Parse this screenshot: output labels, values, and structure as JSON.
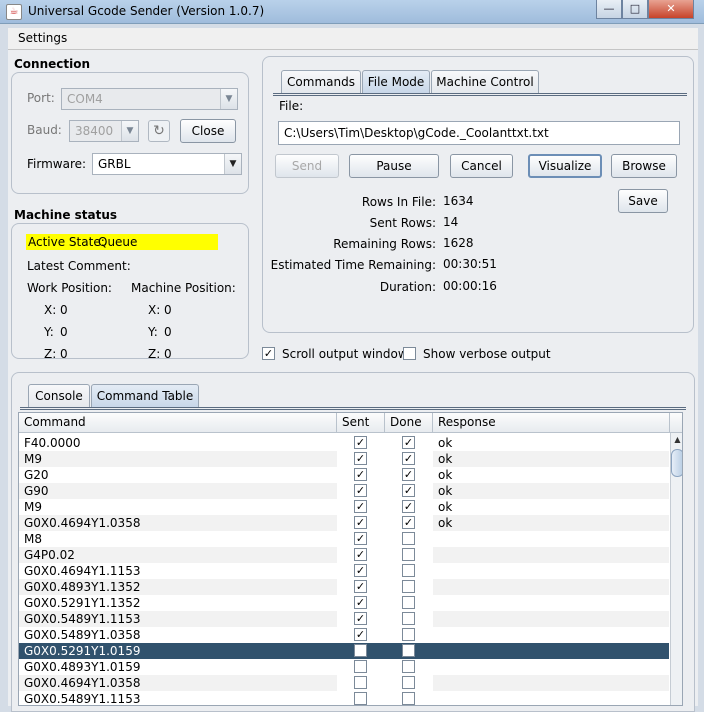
{
  "window": {
    "title": "Universal Gcode Sender (Version 1.0.7)",
    "icon": "java-icon",
    "min": "—",
    "max": "□",
    "close": "✕"
  },
  "menu": {
    "settings": "Settings"
  },
  "connection": {
    "heading": "Connection",
    "port_label": "Port:",
    "port_value": "COM4",
    "baud_label": "Baud:",
    "baud_value": "38400",
    "refresh_icon": "refresh-icon",
    "close_button": "Close",
    "firmware_label": "Firmware:",
    "firmware_value": "GRBL"
  },
  "machine_status": {
    "heading": "Machine status",
    "active_state_label": "Active State:",
    "active_state_value": "Queue",
    "latest_comment_label": "Latest Comment:",
    "work_position_label": "Work Position:",
    "machine_position_label": "Machine Position:",
    "work": {
      "x_label": "X:",
      "x": "0",
      "y_label": "Y:",
      "y": "0",
      "z_label": "Z:",
      "z": "0"
    },
    "machine": {
      "x_label": "X:",
      "x": "0",
      "y_label": "Y:",
      "y": "0",
      "z_label": "Z:",
      "z": "0"
    },
    "highlight_color": "#ffff00"
  },
  "tabs_top": {
    "commands": "Commands",
    "file_mode": "File Mode",
    "machine_control": "Machine Control"
  },
  "file_mode": {
    "file_label": "File:",
    "file_path": "C:\\Users\\Tim\\Desktop\\gCode._Coolanttxt.txt",
    "send": "Send",
    "pause": "Pause",
    "cancel": "Cancel",
    "visualize": "Visualize",
    "browse": "Browse",
    "save": "Save",
    "rows_in_file_label": "Rows In File:",
    "rows_in_file": "1634",
    "sent_rows_label": "Sent Rows:",
    "sent_rows": "14",
    "remaining_rows_label": "Remaining Rows:",
    "remaining_rows": "1628",
    "est_time_label": "Estimated Time Remaining:",
    "est_time": "00:30:51",
    "duration_label": "Duration:",
    "duration": "00:00:16"
  },
  "options": {
    "scroll_output": "Scroll output window",
    "scroll_checked": true,
    "verbose": "Show verbose output",
    "verbose_checked": false
  },
  "tabs_bottom": {
    "console": "Console",
    "command_table": "Command Table"
  },
  "table": {
    "headers": {
      "command": "Command",
      "sent": "Sent",
      "done": "Done",
      "response": "Response"
    },
    "rows": [
      {
        "command": "F40.0000",
        "sent": true,
        "done": true,
        "response": "ok"
      },
      {
        "command": "M9",
        "sent": true,
        "done": true,
        "response": "ok"
      },
      {
        "command": "G20",
        "sent": true,
        "done": true,
        "response": "ok"
      },
      {
        "command": "G90",
        "sent": true,
        "done": true,
        "response": "ok"
      },
      {
        "command": "M9",
        "sent": true,
        "done": true,
        "response": "ok"
      },
      {
        "command": "G0X0.4694Y1.0358",
        "sent": true,
        "done": true,
        "response": "ok"
      },
      {
        "command": "M8",
        "sent": true,
        "done": false,
        "response": ""
      },
      {
        "command": "G4P0.02",
        "sent": true,
        "done": false,
        "response": ""
      },
      {
        "command": "G0X0.4694Y1.1153",
        "sent": true,
        "done": false,
        "response": ""
      },
      {
        "command": "G0X0.4893Y1.1352",
        "sent": true,
        "done": false,
        "response": ""
      },
      {
        "command": "G0X0.5291Y1.1352",
        "sent": true,
        "done": false,
        "response": ""
      },
      {
        "command": "G0X0.5489Y1.1153",
        "sent": true,
        "done": false,
        "response": ""
      },
      {
        "command": "G0X0.5489Y1.0358",
        "sent": true,
        "done": false,
        "response": ""
      },
      {
        "command": "G0X0.5291Y1.0159",
        "sent": true,
        "done": false,
        "response": "",
        "selected": true
      },
      {
        "command": "G0X0.4893Y1.0159",
        "sent": false,
        "done": false,
        "response": ""
      },
      {
        "command": "G0X0.4694Y1.0358",
        "sent": false,
        "done": false,
        "response": ""
      },
      {
        "command": "G0X0.5489Y1.1153",
        "sent": false,
        "done": false,
        "response": ""
      }
    ],
    "selection_color": "#31526d"
  }
}
